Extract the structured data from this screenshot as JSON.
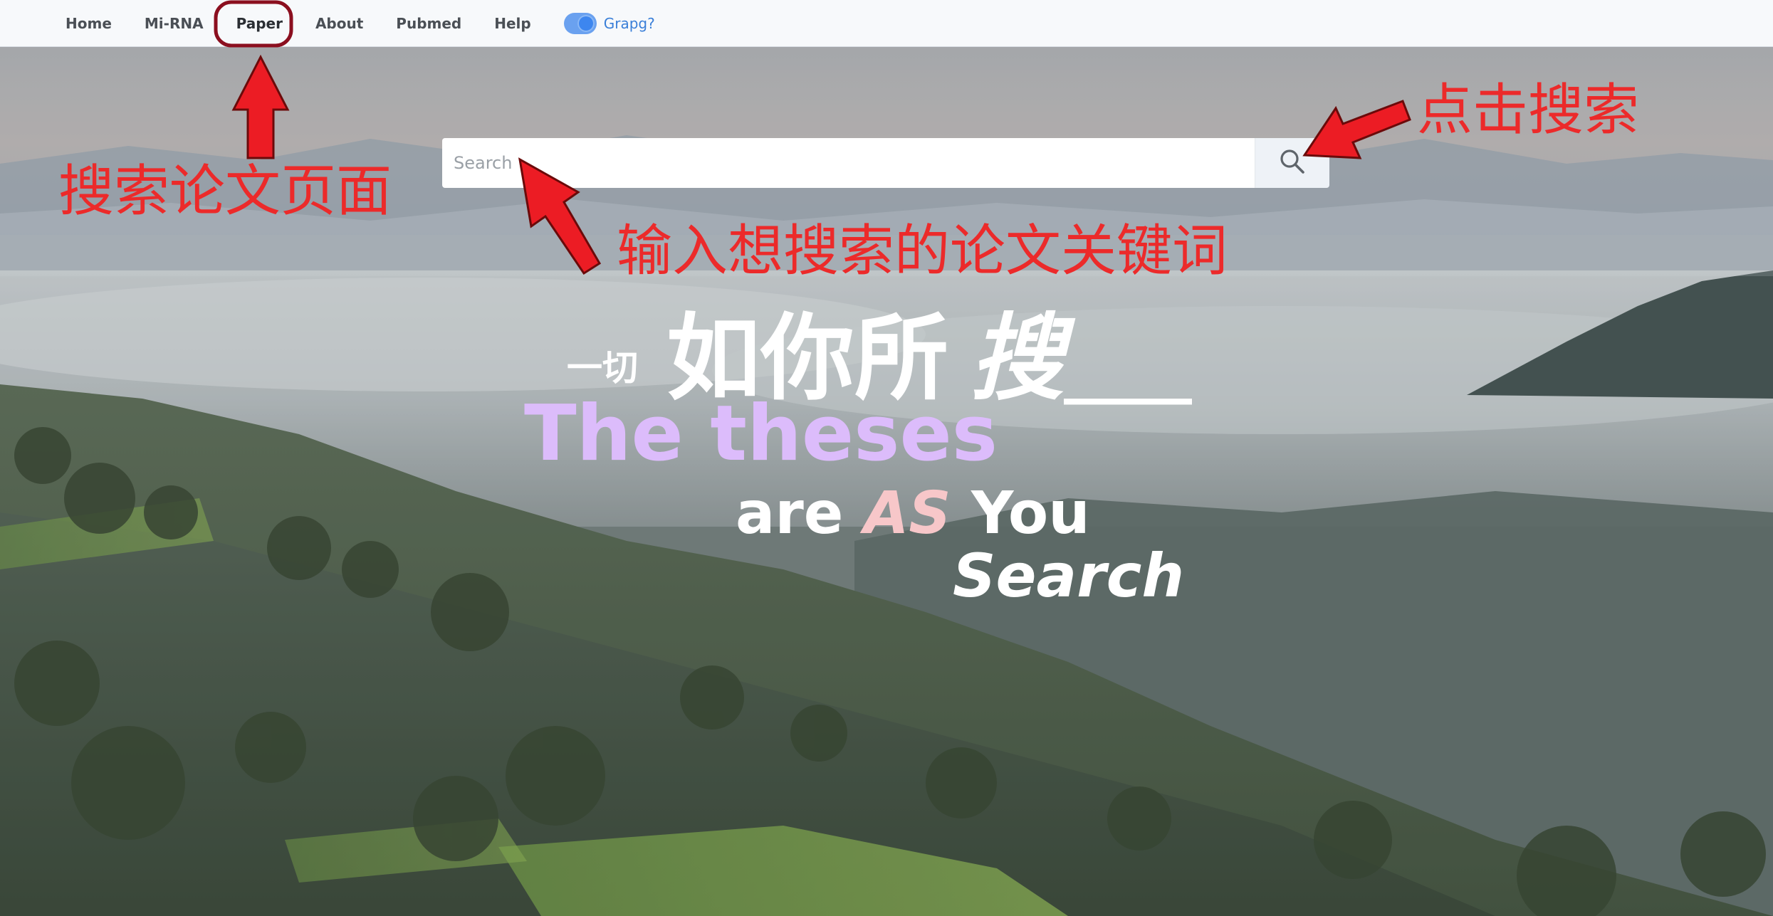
{
  "nav": {
    "items": [
      {
        "label": "Home"
      },
      {
        "label": "Mi-RNA"
      },
      {
        "label": "Paper"
      },
      {
        "label": "About"
      },
      {
        "label": "Pubmed"
      },
      {
        "label": "Help"
      }
    ],
    "toggle_label": "Grapg?",
    "toggle_on": true
  },
  "search": {
    "placeholder": "Search",
    "value": "",
    "button_icon": "search-icon"
  },
  "hero": {
    "line1_small": "一切",
    "line1_big": "如你所",
    "line1_italic": "搜",
    "line1_underscore": "____",
    "line2": "The theses",
    "line3_pre": "are ",
    "line3_as": "AS",
    "line3_post": " You",
    "line4": "Search"
  },
  "annotations": {
    "paper_page": "搜索论文页面",
    "click_search": "点击搜索",
    "input_keywords": "输入想搜索的论文关键词"
  },
  "colors": {
    "annotation_red": "#ec2a2a",
    "highlight_ring": "#8b0f1f",
    "theses_purple": "#dcbcfb",
    "as_pink": "#f7c7c9",
    "toggle_blue": "#3d86ef",
    "nav_bg": "#f7f9fb"
  }
}
